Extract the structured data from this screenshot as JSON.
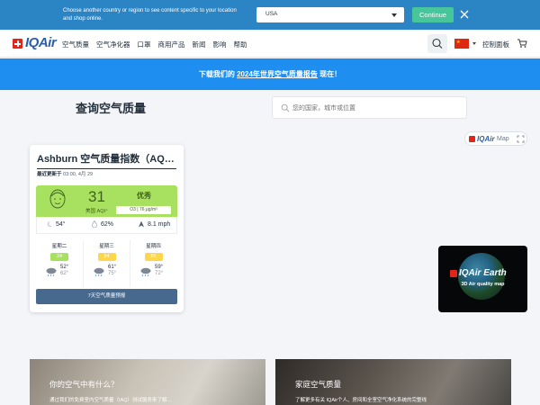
{
  "country_bar": {
    "message": "Choose another country or region to see content specific to your location and shop online.",
    "selected_country": "USA",
    "continue_label": "Continue"
  },
  "nav": {
    "logo": "IQAir",
    "items": [
      "空气质量",
      "空气净化器",
      "口罩",
      "商用产品",
      "新闻",
      "影响",
      "帮助"
    ],
    "dashboard_label": "控制面板"
  },
  "banner": {
    "prefix": "下载我们的 ",
    "link": "2024年世界空气质量报告",
    "suffix": " 现在！"
  },
  "page": {
    "title": "查询空气质量",
    "search_placeholder": "您的国家，城市或位置"
  },
  "map_button": {
    "brand": "IQAir",
    "label": "Map"
  },
  "aqi_card": {
    "city": "Ashburn 空气质量指数（AQI）",
    "updated_label": "最近更新于",
    "updated_value": " 03:00, 4月 29",
    "aqi_value": "31",
    "aqi_unit": "美国 AQI⁺",
    "level": "优秀",
    "pollutant": "O3 | 76 μg/m³",
    "weather": {
      "temp": "54°",
      "humidity": "62%",
      "wind": "8.1 mph"
    },
    "forecast": [
      {
        "day": "星期二",
        "aqi": "24",
        "color": "#a8e05f",
        "high": "52°",
        "low": "62°"
      },
      {
        "day": "星期三",
        "aqi": "54",
        "color": "#fdd64b",
        "high": "61°",
        "low": "75°"
      },
      {
        "day": "星期四",
        "aqi": "55",
        "color": "#fdd64b",
        "high": "59°",
        "low": "72°"
      }
    ],
    "forecast_button": "7天空气质量预报"
  },
  "earth_tile": {
    "brand": "IQAir Earth",
    "subtitle": "3D Air quality map"
  },
  "promos": [
    {
      "title": "你的空气中有什么？",
      "desc": "通过我们的免费室内空气质量（IAQ）测试服务来了解..."
    },
    {
      "title": "家庭空气质量",
      "desc": "了解更多有关 IQAir个人、房间和全室空气净化系统的完整线"
    }
  ],
  "colors": {
    "brand_blue": "#2b5ea7",
    "banner_blue": "#1f8ef1",
    "good_green": "#a8e05f",
    "moderate_yellow": "#fdd64b",
    "continue_green": "#47c69b"
  }
}
